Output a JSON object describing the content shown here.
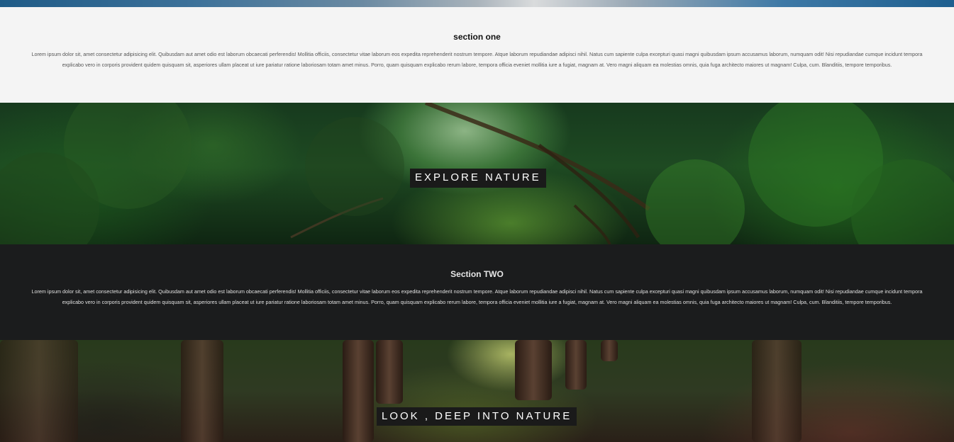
{
  "sections": {
    "one": {
      "title": "section one",
      "body": "Lorem ipsum dolor sit, amet consectetur adipisicing elit. Quibusdam aut amet odio est laborum obcaecati perferendis! Mollitia officiis, consectetur vitae laborum eos expedita reprehenderit nostrum tempore. Atque laborum repudiandae adipisci nihil. Natus cum sapiente culpa excepturi quasi magni quibusdam ipsum accusamus laborum, numquam odit! Nisi repudiandae cumque incidunt tempora explicabo vero in corporis provident quidem quisquam sit, asperiores ullam placeat ut iure pariatur ratione laboriosam totam amet minus. Porro, quam quisquam explicabo rerum labore, tempora officia eveniet mollitia iure a fugiat, magnam at. Vero magni aliquam ea molestias omnis, quia fuga architecto maiores ut magnam! Culpa, cum. Blanditiis, tempore temporibus."
    },
    "two": {
      "title": "Section TWO",
      "body": "Lorem ipsum dolor sit, amet consectetur adipisicing elit. Quibusdam aut amet odio est laborum obcaecati perferendis! Mollitia officiis, consectetur vitae laborum eos expedita reprehenderit nostrum tempore. Atque laborum repudiandae adipisci nihil. Natus cum sapiente culpa excepturi quasi magni quibusdam ipsum accusamus laborum, numquam odit! Nisi repudiandae cumque incidunt tempora explicabo vero in corporis provident quidem quisquam sit, asperiores ullam placeat ut iure pariatur ratione laboriosam totam amet minus. Porro, quam quisquam explicabo rerum labore, tempora officia eveniet mollitia iure a fugiat, magnam at. Vero magni aliquam ea molestias omnis, quia fuga architecto maiores ut magnam! Culpa, cum. Blanditiis, tempore temporibus."
    }
  },
  "banners": {
    "one": {
      "caption": "EXPLORE NATURE"
    },
    "two": {
      "caption": "LOOK , DEEP INTO NATURE"
    }
  },
  "colors": {
    "light_section_bg": "#f4f4f4",
    "dark_section_bg": "#1b1c1d",
    "caption_bg": "#1a1a1a",
    "caption_text": "#ffffff"
  }
}
